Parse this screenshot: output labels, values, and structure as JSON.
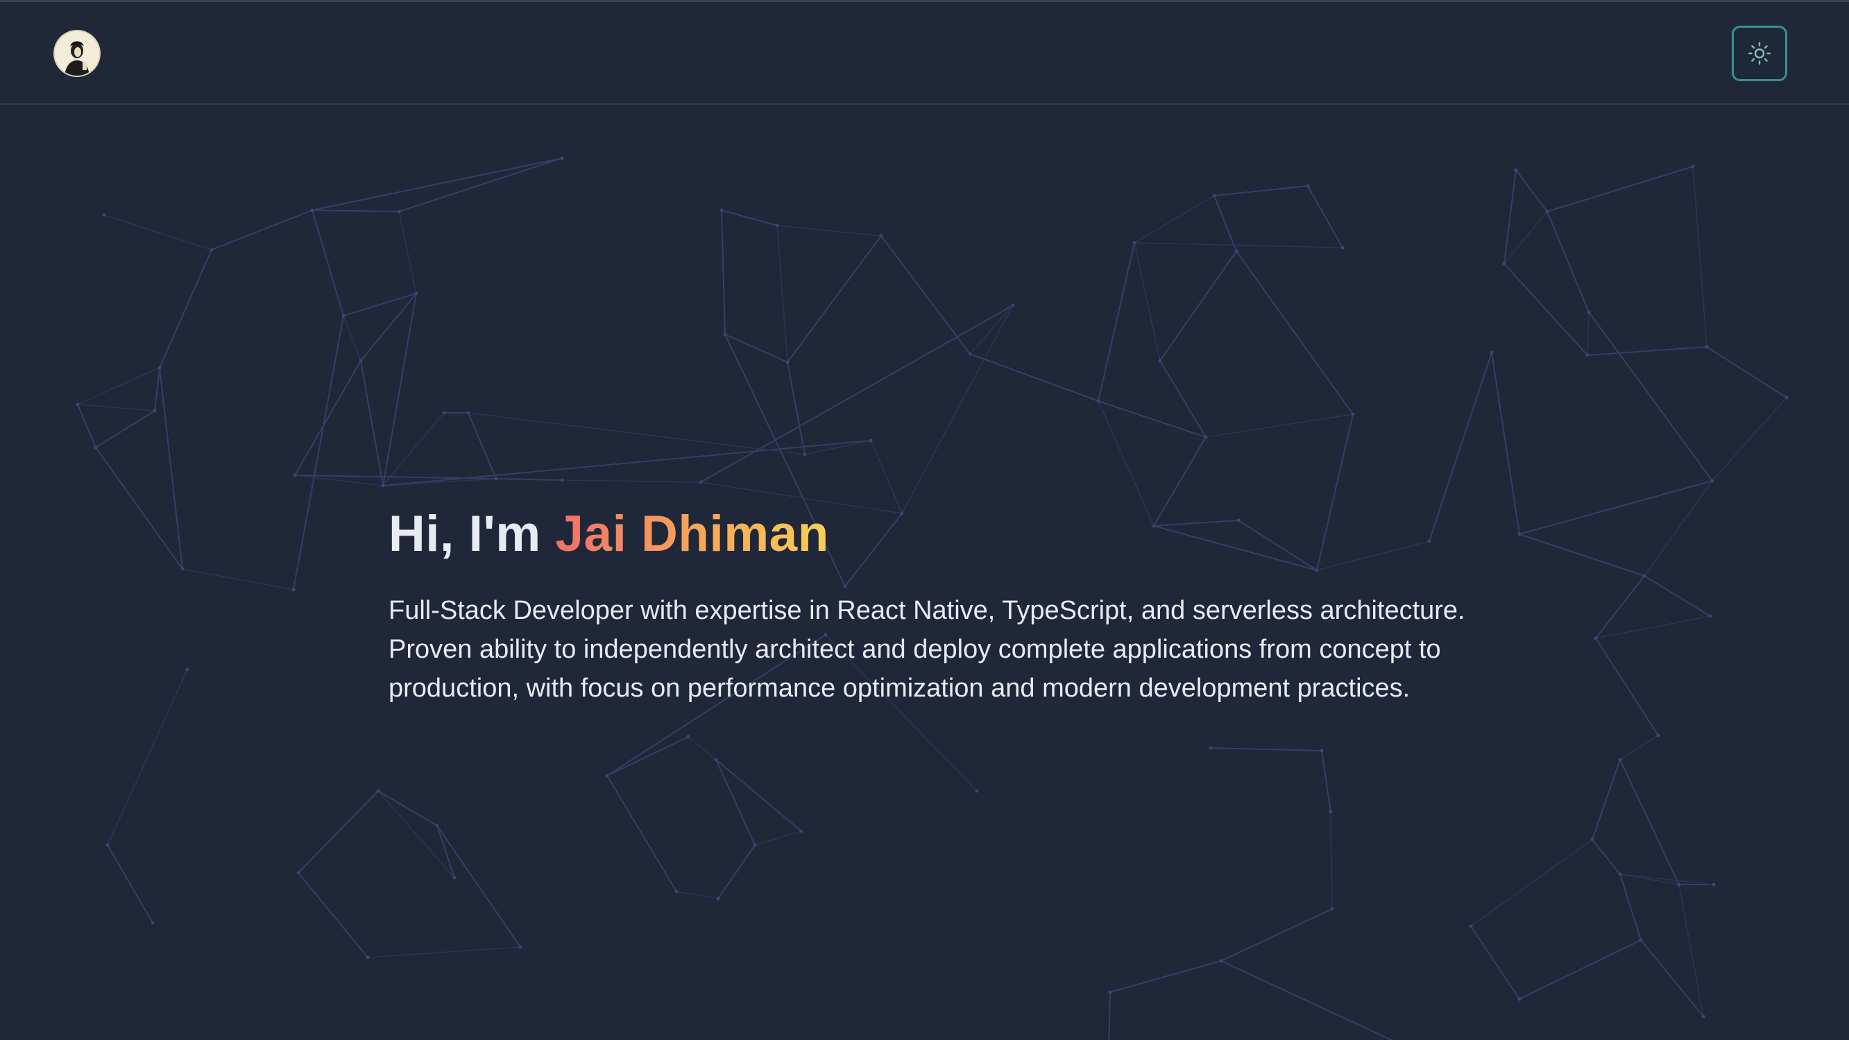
{
  "header": {
    "avatar_icon": "profile-avatar",
    "theme_toggle_icon": "sun-icon"
  },
  "hero": {
    "greeting": "Hi, I'm ",
    "name": "Jai Dhiman",
    "description": "Full-Stack Developer with expertise in React Native, TypeScript, and serverless architecture. Proven ability to independently architect and deploy complete applications from concept to production, with focus on performance optimization and modern development practices."
  },
  "colors": {
    "background": "#1f2739",
    "network_line": "#343f66",
    "toggle_border": "#3b8f93",
    "name_gradient_start": "#ef6f6c",
    "name_gradient_end": "#f8cf55"
  }
}
